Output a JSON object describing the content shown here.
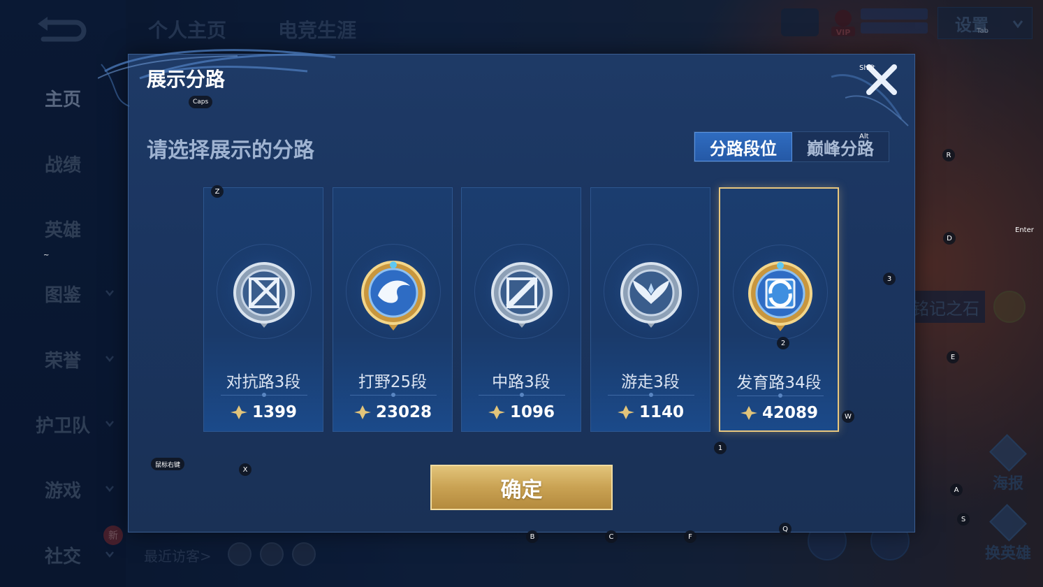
{
  "background": {
    "nav_items": [
      "主页",
      "战绩",
      "英雄",
      "图鉴",
      "荣誉",
      "护卫队",
      "游戏",
      "社交"
    ],
    "active_nav": "主页",
    "new_badge": "新",
    "top_tabs": [
      "个人主页",
      "电竞生涯"
    ],
    "settings_label": "设置",
    "vip_label": "VIP",
    "stone_label": "铭记之石",
    "poster_label": "海报",
    "swap_hero_label": "换英雄",
    "recent_visitors": "最近访客>"
  },
  "modal": {
    "title": "展示分路",
    "subtitle": "请选择展示的分路",
    "segments": [
      "分路段位",
      "巅峰分路"
    ],
    "active_segment": "分路段位",
    "cards": [
      {
        "rank": "对抗路3段",
        "score": "1399",
        "tier": "silver",
        "icon": "clash-lane-icon"
      },
      {
        "rank": "打野25段",
        "score": "23028",
        "tier": "gold",
        "icon": "jungle-dragon-icon"
      },
      {
        "rank": "中路3段",
        "score": "1096",
        "tier": "silver",
        "icon": "mid-lane-icon"
      },
      {
        "rank": "游走3段",
        "score": "1140",
        "tier": "silver",
        "icon": "roam-wings-icon"
      },
      {
        "rank": "发育路34段",
        "score": "42089",
        "tier": "gold",
        "icon": "farm-lane-icon"
      }
    ],
    "selected_card": "发育路34段",
    "confirm_label": "确定"
  },
  "key_hints": {
    "tab": "Tab",
    "shift": "Shift",
    "caps": "Caps",
    "alt": "Alt",
    "enter": "Enter",
    "z": "Z",
    "r": "R",
    "d": "D",
    "three": "3",
    "e": "E",
    "two": "2",
    "w": "W",
    "one": "1",
    "mouse_right": "鼠标右键",
    "x": "X",
    "a": "A",
    "s": "S",
    "b": "B",
    "c": "C",
    "f": "F",
    "q": "Q",
    "tilde": "~"
  },
  "colors": {
    "modal_bg": "#1e3a66",
    "segment_active": "#2f6cc0",
    "confirm_gold": "#c9a253",
    "selected_border": "#e8c77e"
  }
}
